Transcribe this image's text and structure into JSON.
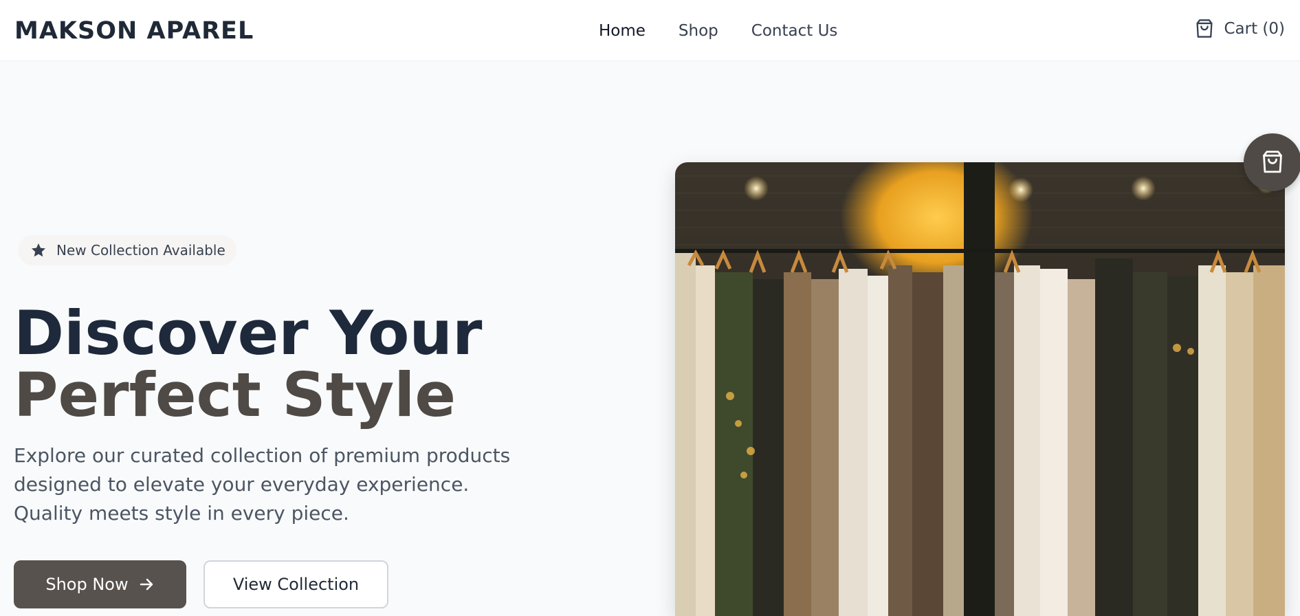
{
  "header": {
    "brand": "MAKSON APAREL",
    "nav": [
      "Home",
      "Shop",
      "Contact Us"
    ],
    "cart_label": "Cart (0)",
    "cart_icon": "shopping-bag-icon"
  },
  "hero": {
    "badge_icon": "star-icon",
    "badge_text": "New Collection Available",
    "title_line1": "Discover Your",
    "title_line2": "Perfect Style",
    "description": "Explore our curated collection of premium products designed to elevate your everyday experience. Quality meets style in every piece.",
    "primary_button": "Shop Now",
    "secondary_button": "View Collection",
    "image": "clothing-rack-photo",
    "floating_icon": "shopping-bag-icon"
  },
  "colors": {
    "primary": "#57524d",
    "heading": "#1e293b",
    "accent_heading": "#4f4a45",
    "background": "#f9fafb"
  }
}
